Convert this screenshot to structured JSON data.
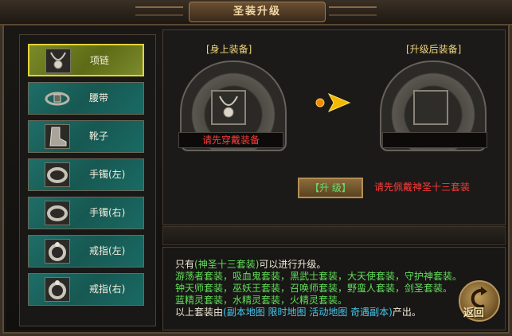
{
  "window": {
    "title": "圣装升级"
  },
  "equipment_list": [
    {
      "label": "项链",
      "icon": "necklace-icon",
      "selected": true
    },
    {
      "label": "腰带",
      "icon": "belt-icon",
      "selected": false
    },
    {
      "label": "靴子",
      "icon": "boots-icon",
      "selected": false
    },
    {
      "label": "手镯(左)",
      "icon": "bracelet-icon",
      "selected": false
    },
    {
      "label": "手镯(右)",
      "icon": "bracelet-icon",
      "selected": false
    },
    {
      "label": "戒指(左)",
      "icon": "ring-icon",
      "selected": false
    },
    {
      "label": "戒指(右)",
      "icon": "ring-icon",
      "selected": false
    }
  ],
  "upgrade": {
    "current_label": "[身上装备]",
    "result_label": "[升级后装备]",
    "current_status": "请先穿戴装备",
    "button_label": "【升 级】",
    "warning": "请先佩戴神圣十三套装"
  },
  "info": {
    "line1_pre": "只有",
    "line1_highlight": "(神圣十三套装)",
    "line1_post": "可以进行升级。",
    "line2": "游荡者套装，吸血鬼套装，黑武士套装，大天使套装，守护神套装。",
    "line3": "钟天师套装，巫妖王套装，召唤师套装，野蛮人套装，剑圣套装。",
    "line4": "蓝精灵套装，水精灵套装，火精灵套装。",
    "line5_pre": "以上套装由",
    "line5_links": "(副本地图  限时地图  活动地图  奇遇副本)",
    "line5_post": "产出。"
  },
  "back_button": {
    "label": "返回"
  },
  "colors": {
    "selected_item": "#6b7a1e",
    "item_teal": "#1b625c",
    "warning_red": "#ff3a3a",
    "info_green": "#62e05a",
    "link_cyan": "#46c8f0",
    "arrow_yellow": "#f5b800"
  }
}
